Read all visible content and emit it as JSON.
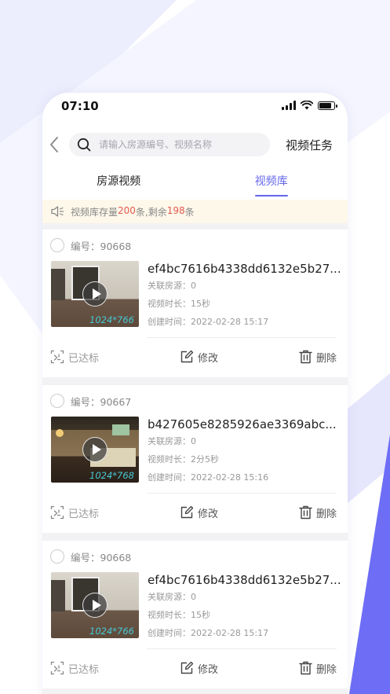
{
  "status": {
    "time": "07:10"
  },
  "search": {
    "placeholder": "请输入房源编号、视频名称",
    "task_label": "视频任务"
  },
  "tabs": [
    {
      "label": "房源视频",
      "active": false
    },
    {
      "label": "视频库",
      "active": true
    }
  ],
  "notice": {
    "prefix": "视频库存量",
    "total": "200",
    "mid": "条,剩余",
    "remain": "198",
    "suffix": "条"
  },
  "cards": [
    {
      "id_label": "编号：90668",
      "title": "ef4bc7616b4338dd6132e5b27...",
      "linked": "关联房源：0",
      "duration": "视频时长：15秒",
      "created": "创建时间：2022-02-28 15:17",
      "resolution": "1024*766",
      "thumb": "bright",
      "reach": "已达标",
      "edit": "修改",
      "delete": "删除"
    },
    {
      "id_label": "编号：90667",
      "title": "b427605e8285926ae3369abc...",
      "linked": "关联房源：0",
      "duration": "视频时长：2分5秒",
      "created": "创建时间：2022-02-28 15:16",
      "resolution": "1024*768",
      "thumb": "dark",
      "reach": "已达标",
      "edit": "修改",
      "delete": "删除"
    },
    {
      "id_label": "编号：90668",
      "title": "ef4bc7616b4338dd6132e5b27...",
      "linked": "关联房源：0",
      "duration": "视频时长：15秒",
      "created": "创建时间：2022-02-28 15:17",
      "resolution": "1024*766",
      "thumb": "bright",
      "reach": "已达标",
      "edit": "修改",
      "delete": "删除"
    }
  ],
  "colors": {
    "accent": "#6466ee",
    "highlight": "#e5584f",
    "resolution": "#46c9d6"
  },
  "icons": [
    "back-chevron-icon",
    "search-icon",
    "speaker-icon",
    "play-icon",
    "reach-standard-icon",
    "edit-icon",
    "trash-icon"
  ]
}
